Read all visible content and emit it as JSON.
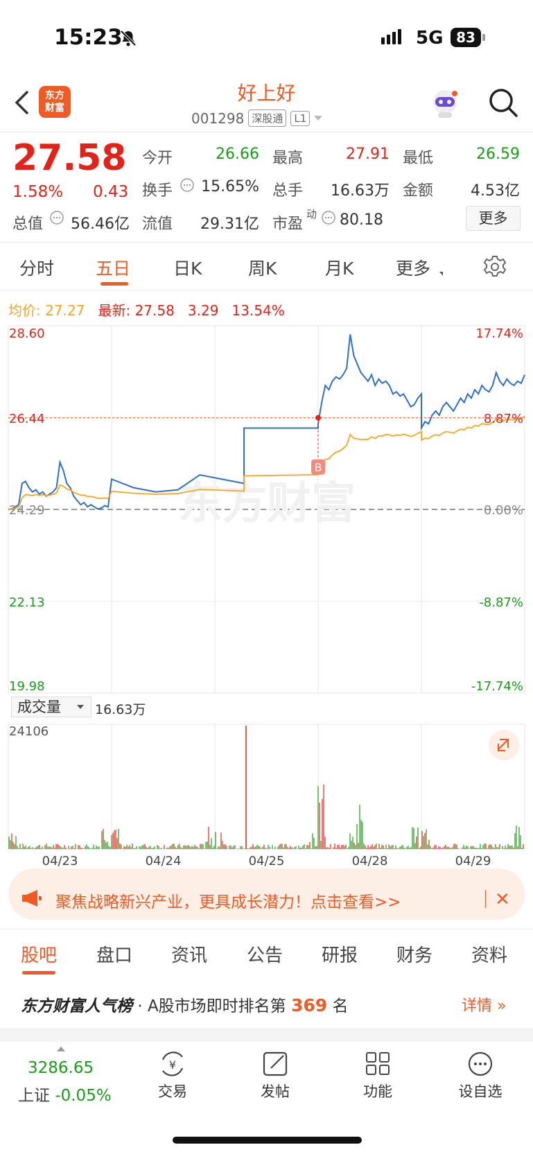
{
  "status_bar": {
    "time": "15:23",
    "network": "5G",
    "battery": "83"
  },
  "header": {
    "title": "好上好",
    "code": "001298",
    "tag1": "深股通",
    "tag2": "L1",
    "logo_line1": "东方",
    "logo_line2": "财富"
  },
  "quote": {
    "price": "27.58",
    "change_pct": "1.58%",
    "change": "0.43",
    "open_label": "今开",
    "open": "26.66",
    "high_label": "最高",
    "high": "27.91",
    "low_label": "最低",
    "low": "26.59",
    "turnover_label": "换手",
    "turnover": "15.65%",
    "volume_label": "总手",
    "volume": "16.63万",
    "amount_label": "金额",
    "amount": "4.53亿",
    "mcap_label": "总值",
    "mcap": "56.46亿",
    "float_label": "流值",
    "float_cap": "29.31亿",
    "pe_label": "市盈",
    "pe_sup": "动",
    "pe": "80.18",
    "more_btn": "更多"
  },
  "tabs": [
    "分时",
    "五日",
    "日K",
    "周K",
    "月K",
    "更多"
  ],
  "legend": {
    "avg_label": "均价:",
    "avg": "27.27",
    "latest_label": "最新:",
    "latest": "27.58",
    "chg": "3.29",
    "chg_pct": "13.54%"
  },
  "watermark": "东方财富",
  "chart_data": {
    "type": "line",
    "title": "",
    "y_left_labels": [
      "28.60",
      "26.44",
      "24.29",
      "22.13",
      "19.98"
    ],
    "y_right_labels": [
      "17.74%",
      "8.87%",
      "0.00%",
      "-8.87%",
      "-17.74%"
    ],
    "ylim": [
      19.98,
      28.6
    ],
    "prev_close": 24.29,
    "buy_marker": {
      "label": "B",
      "price": 26.44
    },
    "x_labels": [
      "04/23",
      "04/24",
      "04/25",
      "04/28",
      "04/29"
    ],
    "series": [
      {
        "name": "最新",
        "color": "#2f6fc6",
        "days": [
          [
            24.29,
            24.3,
            24.35,
            24.4,
            24.9,
            24.95,
            24.8,
            24.7,
            24.75,
            24.65,
            24.7,
            24.6,
            24.65,
            24.7,
            24.8,
            25.4,
            25.2,
            24.9,
            24.8,
            24.6,
            24.5,
            24.4,
            24.45,
            24.35,
            24.4,
            24.35,
            24.3,
            24.32,
            24.38,
            24.35
          ],
          [
            25.0,
            24.8,
            24.7,
            24.75,
            25.1,
            25.0,
            24.9,
            26.2,
            26.2,
            26.2,
            26.2,
            26.2,
            26.2,
            26.2,
            26.2,
            26.2,
            26.2,
            26.2,
            26.2,
            26.2,
            26.2,
            26.2,
            26.2,
            26.2,
            26.2,
            26.2,
            26.2,
            26.2,
            26.2,
            26.3
          ],
          [
            26.3,
            26.8,
            27.2,
            27.1,
            27.3,
            27.4,
            27.35,
            27.45,
            27.6,
            28.4,
            27.9,
            27.7,
            27.5,
            27.4,
            27.3,
            27.45,
            27.2,
            27.35,
            27.25,
            27.3,
            27.2,
            27.0,
            27.05,
            26.95,
            27.0,
            26.85,
            26.7,
            26.75,
            26.9,
            27.0
          ],
          [
            26.2,
            26.35,
            26.3,
            26.5,
            26.6,
            26.5,
            26.7,
            26.8,
            26.7,
            26.6,
            26.75,
            26.9,
            26.8,
            27.0,
            26.9,
            27.1,
            27.0,
            27.2,
            27.1,
            27.05,
            27.2,
            27.5,
            27.3,
            27.2,
            27.35,
            27.25,
            27.2,
            27.3,
            27.25,
            27.45
          ]
        ]
      },
      {
        "name": "均价",
        "color": "#f6a623"
      }
    ]
  },
  "volume": {
    "selector": "成交量",
    "total": "16.63万",
    "max_label": "24106"
  },
  "banner": {
    "text": "聚焦战略新兴产业，更具成长潜力！点击查看>>"
  },
  "bottom_tabs": [
    "股吧",
    "盘口",
    "资讯",
    "公告",
    "研报",
    "财务",
    "资料"
  ],
  "rank": {
    "brand": "东方财富人气榜",
    "dot": "·",
    "text": "A股市场即时排名第",
    "num": "369",
    "suffix": "名",
    "detail": "详情"
  },
  "footer": {
    "index_value": "3286.65",
    "index_name": "上证",
    "index_change": "-0.05%",
    "nav": [
      "交易",
      "发帖",
      "功能",
      "设自选"
    ]
  }
}
